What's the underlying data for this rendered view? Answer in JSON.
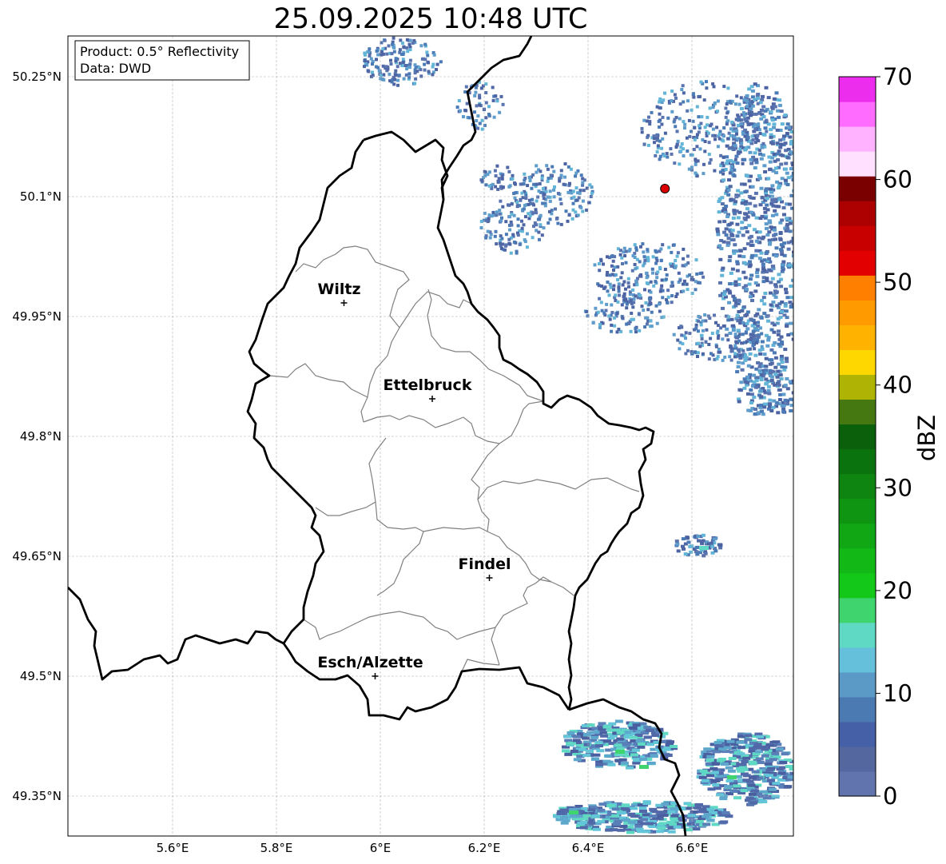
{
  "title": "25.09.2025 10:48 UTC",
  "info": {
    "product": "Product: 0.5° Reflectivity",
    "data": "Data: DWD"
  },
  "lat_ticks": [
    "50.25°N",
    "50.1°N",
    "49.95°N",
    "49.8°N",
    "49.65°N",
    "49.5°N",
    "49.35°N"
  ],
  "lon_ticks": [
    "5.6°E",
    "5.8°E",
    "6°E",
    "6.2°E",
    "6.4°E",
    "6.6°E"
  ],
  "cities": [
    {
      "name": "Wiltz",
      "lon": 5.93,
      "lat": 49.967
    },
    {
      "name": "Ettelbruck",
      "lon": 6.1,
      "lat": 49.847
    },
    {
      "name": "Findel",
      "lon": 6.21,
      "lat": 49.623
    },
    {
      "name": "Esch/Alzette",
      "lon": 5.99,
      "lat": 49.5
    }
  ],
  "radar_site": {
    "lon": 6.548,
    "lat": 50.11,
    "color": "#dd0000"
  },
  "colorbar": {
    "label": "dBZ",
    "min": 0,
    "max": 70,
    "ticks": [
      "0",
      "10",
      "20",
      "30",
      "40",
      "50",
      "60",
      "70"
    ],
    "colors": [
      "#6274ad",
      "#54689f",
      "#4560a6",
      "#4b79b2",
      "#5b9ac7",
      "#65c0dc",
      "#5fd8c4",
      "#3fd46e",
      "#14c81a",
      "#12b816",
      "#11a614",
      "#0f9512",
      "#0d8510",
      "#0b730d",
      "#0a600b",
      "#457810",
      "#afb303",
      "#ffd700",
      "#ffb200",
      "#ff9a00",
      "#ff7f00",
      "#e30000",
      "#c80000",
      "#ad0000",
      "#7a0000",
      "#ffe0ff",
      "#ffb2ff",
      "#ff6cff",
      "#ec2ded"
    ]
  },
  "colors": {
    "border": "#000000",
    "cantons": "#808080",
    "grid": "#b0b0b0"
  }
}
